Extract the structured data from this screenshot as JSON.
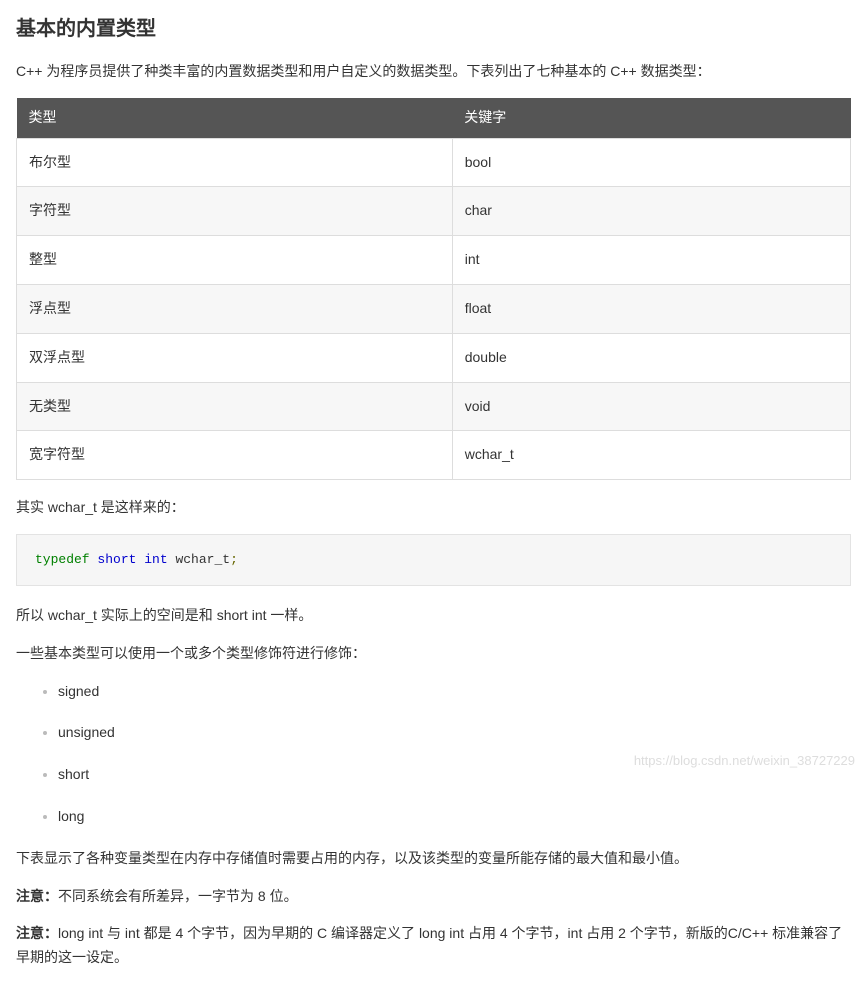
{
  "heading": "基本的内置类型",
  "intro": "C++ 为程序员提供了种类丰富的内置数据类型和用户自定义的数据类型。下表列出了七种基本的 C++ 数据类型：",
  "table": {
    "headers": [
      "类型",
      "关键字"
    ],
    "rows": [
      [
        "布尔型",
        "bool"
      ],
      [
        "字符型",
        "char"
      ],
      [
        "整型",
        "int"
      ],
      [
        "浮点型",
        "float"
      ],
      [
        "双浮点型",
        "double"
      ],
      [
        "无类型",
        "void"
      ],
      [
        "宽字符型",
        "wchar_t"
      ]
    ]
  },
  "para_wchar_intro": "其实 wchar_t 是这样来的：",
  "code": {
    "typedef": "typedef",
    "types": "short int",
    "name": "wchar_t",
    "semi": ";"
  },
  "para_wchar_space": "所以 wchar_t 实际上的空间是和 short int 一样。",
  "para_modifiers_intro": "一些基本类型可以使用一个或多个类型修饰符进行修饰：",
  "modifiers": [
    "signed",
    "unsigned",
    "short",
    "long"
  ],
  "para_table_intro": "下表显示了各种变量类型在内存中存储值时需要占用的内存，以及该类型的变量所能存储的最大值和最小值。",
  "note1_label": "注意：",
  "note1_text": "不同系统会有所差异，一字节为 8 位。",
  "note2_label": "注意：",
  "note2_text": "long int 与 int 都是 4 个字节，因为早期的 C 编译器定义了 long int 占用 4 个字节，int 占用 2 个字节，新版的C/C++ 标准兼容了早期的这一设定。",
  "watermark": "https://blog.csdn.net/weixin_38727229"
}
